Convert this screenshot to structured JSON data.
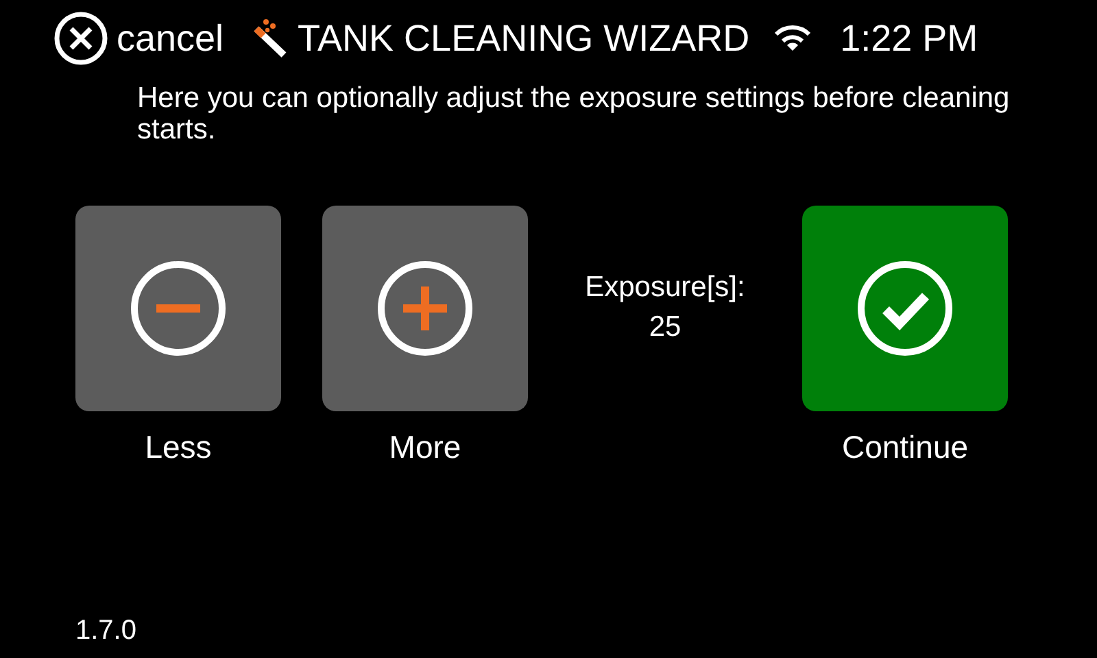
{
  "header": {
    "cancel_label": "cancel",
    "title": "TANK CLEANING WIZARD",
    "time": "1:22 PM"
  },
  "description": "Here you can optionally adjust the exposure settings before cleaning starts.",
  "actions": [
    {
      "kind": "minus",
      "label": "Less"
    },
    {
      "kind": "plus",
      "label": "More"
    },
    {
      "kind": "confirm",
      "label": "Continue"
    }
  ],
  "exposure": {
    "label": "Exposure[s]:",
    "value": "25"
  },
  "version": "1.7.0"
}
